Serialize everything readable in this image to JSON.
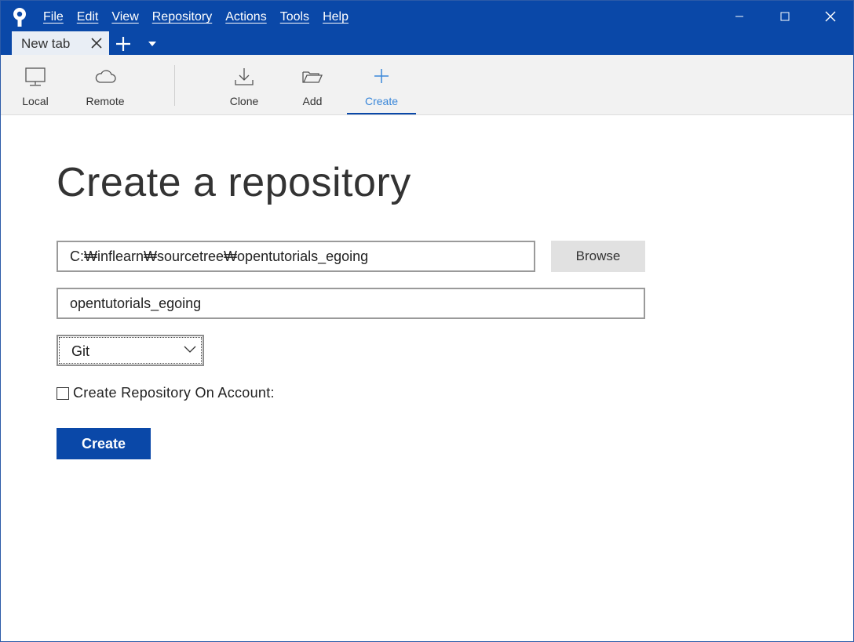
{
  "menu": {
    "items": [
      {
        "label": "File"
      },
      {
        "label": "Edit"
      },
      {
        "label": "View"
      },
      {
        "label": "Repository"
      },
      {
        "label": "Actions"
      },
      {
        "label": "Tools"
      },
      {
        "label": "Help"
      }
    ]
  },
  "window_controls": {
    "minimize_icon": "minimize-icon",
    "maximize_icon": "maximize-icon",
    "close_icon": "close-icon"
  },
  "tabs": [
    {
      "label": "New tab",
      "active": true
    }
  ],
  "toolbar": {
    "items": [
      {
        "label": "Local",
        "icon": "monitor-icon",
        "active": false
      },
      {
        "label": "Remote",
        "icon": "cloud-icon",
        "active": false
      },
      {
        "label": "Clone",
        "icon": "download-icon",
        "active": false
      },
      {
        "label": "Add",
        "icon": "folder-open-icon",
        "active": false
      },
      {
        "label": "Create",
        "icon": "plus-icon",
        "active": true
      }
    ]
  },
  "form": {
    "title": "Create a repository",
    "path_value": "C:₩inflearn₩sourcetree₩opentutorials_egoing",
    "browse_label": "Browse",
    "name_value": "opentutorials_egoing",
    "vcs_selected": "Git",
    "checkbox_label": "Create Repository On Account:",
    "checkbox_checked": false,
    "create_label": "Create"
  },
  "colors": {
    "brand": "#0a48a8",
    "active_tab_text": "#3a87d9",
    "toolbar_bg": "#f2f2f2"
  }
}
